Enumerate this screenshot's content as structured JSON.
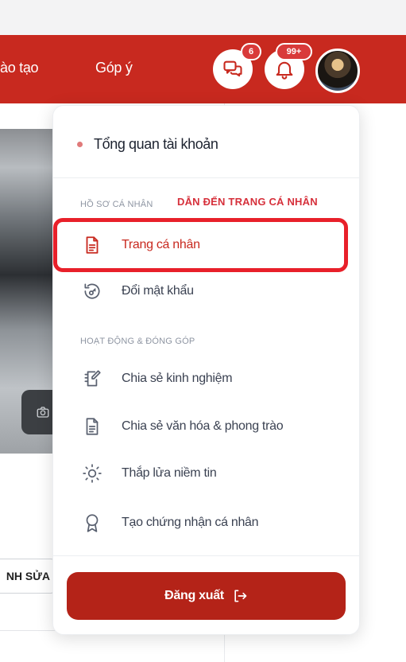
{
  "nav": {
    "links": [
      "ào tạo",
      "Góp ý"
    ],
    "message_badge": "6",
    "notification_badge": "99+",
    "brand_color": "#c8291f"
  },
  "profile": {
    "edit_button_label": "NH SỬA"
  },
  "dropdown": {
    "overview_label": "Tổng quan tài khoản",
    "section_profile": "HỒ SƠ CÁ NHÂN",
    "annotation": "DẪN ĐẾN TRANG CÁ NHÂN",
    "item_personal_page": "Trang cá nhân",
    "item_change_password": "Đổi mật khẩu",
    "section_activity": "HOẠT ĐỘNG & ĐÓNG GÓP",
    "item_share_experience": "Chia sẻ kinh nghiệm",
    "item_share_culture": "Chia sẻ văn hóa & phong trào",
    "item_light_faith": "Thắp lửa niềm tin",
    "item_certificate": "Tạo chứng nhận cá nhân",
    "logout_label": "Đăng xuất"
  },
  "icons": {
    "message": "chat-bubbles-icon",
    "notification": "bell-icon",
    "personal_page": "document-icon",
    "change_password": "reset-key-icon",
    "share_experience": "notebook-pen-icon",
    "share_culture": "document-icon",
    "light_faith": "sun-icon",
    "certificate": "award-ribbon-icon",
    "logout": "logout-arrow-icon",
    "camera": "camera-icon"
  }
}
